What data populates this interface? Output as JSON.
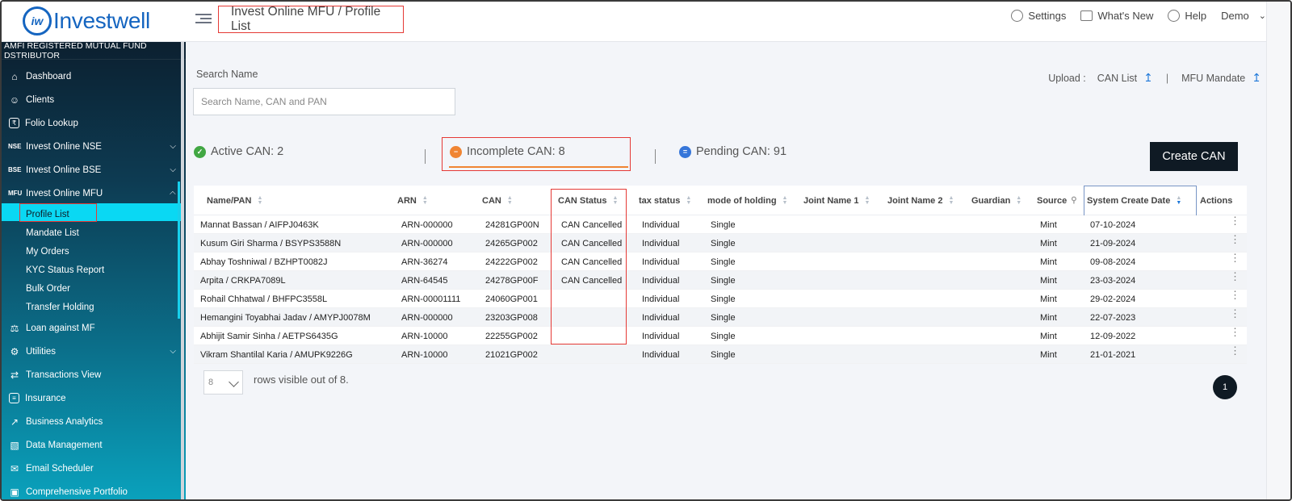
{
  "app": {
    "logo_text": "Investwell",
    "logo_mark": "iw"
  },
  "header": {
    "page_title": "Invest Online MFU / Profile List",
    "links": [
      {
        "label": "Settings",
        "icon": "gear-icon"
      },
      {
        "label": "What's New",
        "icon": "chat-icon"
      },
      {
        "label": "Help",
        "icon": "lifebuoy-icon"
      },
      {
        "label": "Demo",
        "icon": "chevron-down-icon"
      }
    ]
  },
  "sidebar": {
    "banner": "AMFI REGISTERED MUTUAL FUND DSTRIBUTOR",
    "items": [
      {
        "label": "Dashboard",
        "icon": "home-icon"
      },
      {
        "label": "Clients",
        "icon": "users-icon"
      },
      {
        "label": "Folio Lookup",
        "icon": "folio-icon"
      },
      {
        "label": "Invest Online NSE",
        "tag": "NSE"
      },
      {
        "label": "Invest Online BSE",
        "tag": "BSE"
      },
      {
        "label": "Invest Online MFU",
        "tag": "MFU"
      }
    ],
    "mfu_sub": [
      "Profile List",
      "Mandate List",
      "My Orders",
      "KYC Status Report",
      "Bulk Order",
      "Transfer Holding"
    ],
    "items2": [
      {
        "label": "Loan against MF",
        "icon": "loan-icon"
      },
      {
        "label": "Utilities",
        "icon": "utilities-icon"
      },
      {
        "label": "Transactions View",
        "icon": "transfer-icon"
      },
      {
        "label": "Insurance",
        "icon": "insurance-icon"
      },
      {
        "label": "Business Analytics",
        "icon": "chart-icon"
      },
      {
        "label": "Data Management",
        "icon": "database-icon"
      },
      {
        "label": "Email Scheduler",
        "icon": "mail-icon"
      },
      {
        "label": "Comprehensive Portfolio",
        "icon": "briefcase-icon"
      }
    ]
  },
  "search": {
    "label": "Search Name",
    "placeholder": "Search Name, CAN and PAN"
  },
  "upload": {
    "label": "Upload :",
    "can_list": "CAN List",
    "mfu_mandate": "MFU Mandate"
  },
  "stats": {
    "active": "Active CAN: 2",
    "incomplete": "Incomplete CAN: 8",
    "pending": "Pending CAN: 91"
  },
  "create_button": "Create CAN",
  "table": {
    "columns": [
      "Name/PAN",
      "ARN",
      "CAN",
      "CAN Status",
      "tax status",
      "mode of holding",
      "Joint Name 1",
      "Joint Name 2",
      "Guardian",
      "Source",
      "System Create Date",
      "Actions"
    ],
    "rows": [
      [
        "Mannat Bassan / AIFPJ0463K",
        "ARN-000000",
        "24281GP00N",
        "CAN Cancelled",
        "Individual",
        "Single",
        "Mint",
        "07-10-2024"
      ],
      [
        "Kusum Giri Sharma / BSYPS3588N",
        "ARN-000000",
        "24265GP002",
        "CAN Cancelled",
        "Individual",
        "Single",
        "Mint",
        "21-09-2024"
      ],
      [
        "Abhay Toshniwal / BZHPT0082J",
        "ARN-36274",
        "24222GP002",
        "CAN Cancelled",
        "Individual",
        "Single",
        "Mint",
        "09-08-2024"
      ],
      [
        "Arpita / CRKPA7089L",
        "ARN-64545",
        "24278GP00F",
        "CAN Cancelled",
        "Individual",
        "Single",
        "Mint",
        "23-03-2024"
      ],
      [
        "Rohail Chhatwal / BHFPC3558L",
        "ARN-00001111",
        "24060GP001",
        "",
        "Individual",
        "Single",
        "Mint",
        "29-02-2024"
      ],
      [
        "Hemangini Toyabhai Jadav / AMYPJ0078M",
        "ARN-000000",
        "23203GP008",
        "",
        "Individual",
        "Single",
        "Mint",
        "22-07-2023"
      ],
      [
        "Abhijit Samir Sinha / AETPS6435G",
        "ARN-10000",
        "22255GP002",
        "",
        "Individual",
        "Single",
        "Mint",
        "12-09-2022"
      ],
      [
        "Vikram Shantilal Karia / AMUPK9226G",
        "ARN-10000",
        "21021GP002",
        "",
        "Individual",
        "Single",
        "Mint",
        "21-01-2021"
      ]
    ]
  },
  "pager": {
    "rows_value": "8",
    "text": "rows visible out of 8.",
    "page": "1"
  },
  "colors": {
    "accent": "#1565c0",
    "highlight": "#e53935",
    "dark_button": "#0f1a24"
  }
}
